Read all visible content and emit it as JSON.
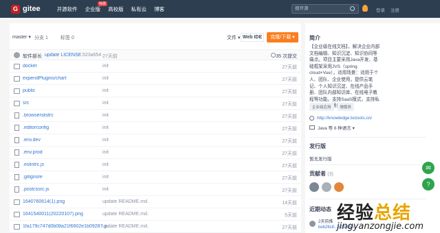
{
  "header": {
    "logo_letter": "G",
    "logo_text": "gitee",
    "nav": [
      {
        "label": "开源软件"
      },
      {
        "label": "企业版",
        "badge": "特惠"
      },
      {
        "label": "高校版"
      },
      {
        "label": "私有云"
      },
      {
        "label": "博客"
      }
    ],
    "search_placeholder": "搜开源",
    "login": "登录",
    "register": "注册"
  },
  "repo": {
    "branch": "master ▾",
    "branches": "分支 1",
    "tags": "标签 0",
    "file_menu": "文件 ▾",
    "webide": "Web IDE",
    "clone": "克隆/下载 ▾"
  },
  "commit": {
    "author": "软件部长",
    "message": "update LICENSE.",
    "sha": "523a654",
    "time": "27天前",
    "count": "35 次提交"
  },
  "files": [
    {
      "type": "folder",
      "name": "docker",
      "msg": "init",
      "time": "27天前"
    },
    {
      "type": "folder",
      "name": "expendPlugins/chart",
      "msg": "init",
      "time": "27天前"
    },
    {
      "type": "folder",
      "name": "public",
      "msg": "init",
      "time": "27天前"
    },
    {
      "type": "folder",
      "name": "src",
      "msg": "init",
      "time": "27天前"
    },
    {
      "type": "file",
      "name": ".browserslistrc",
      "msg": "init",
      "time": "27天前"
    },
    {
      "type": "file",
      "name": ".editorconfig",
      "msg": "init",
      "time": "27天前"
    },
    {
      "type": "file",
      "name": ".env.dev",
      "msg": "init",
      "time": "27天前"
    },
    {
      "type": "file",
      "name": ".env.prod",
      "msg": "init",
      "time": "27天前"
    },
    {
      "type": "file",
      "name": ".eslintrc.js",
      "msg": "init",
      "time": "27天前"
    },
    {
      "type": "file",
      "name": ".gitignore",
      "msg": "init",
      "time": "27天前"
    },
    {
      "type": "file",
      "name": ".postcssrc.js",
      "msg": "init",
      "time": "27天前"
    },
    {
      "type": "image",
      "name": "1640760614(1).png",
      "msg": "update README.md.",
      "time": "14天前"
    },
    {
      "type": "image",
      "name": "1641540011(20220107).png",
      "msg": "update README.md.",
      "time": "5天前"
    },
    {
      "type": "image",
      "name": "1fa179c747d0b08a21f6602e1b09287.p...",
      "msg": "update README.md.",
      "time": "27天前"
    }
  ],
  "sidebar": {
    "intro_title": "简介",
    "intro": "【企业级在线文档】，解决企业内部文档编辑、知识沉淀、知识协同等痛点。项目主要采用Java开发、基础框架采用JVS（spring cloud+Vue），适用场景：适用于个人、团队、企业使用，提供云笔记、个人知识沉淀、在线产品手册、团队内部知识库、在线电子教程等功能。支持SaaS模式，支持私有化部署等场景。",
    "tags": [
      "企业级应用",
      "微服务"
    ],
    "link": "http://knowledge.bctools.cn/",
    "language": "Java 等 6 种语言 ▾",
    "release_title": "发行版",
    "release_none": "暂无发行版",
    "contrib_title": "贡献者",
    "contrib_count": "(3)",
    "activity_title": "近期动态",
    "activity_line1": "2天前推",
    "activity_line2": "beb26c8...523a654"
  },
  "colors": {
    "topbar": "#2c3e50",
    "clone": "#fa7e1e",
    "link": "#2f74d0"
  },
  "watermark": {
    "big_a": "经验",
    "big_b": "总结",
    "url": "jingyanzongjie.com"
  }
}
